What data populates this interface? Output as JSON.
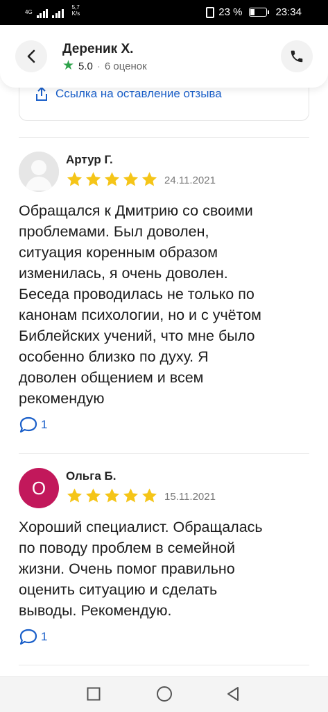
{
  "status_bar": {
    "network_type": "4G",
    "net_speed_value": "5,7",
    "net_speed_unit": "K/s",
    "battery": "23 %",
    "time": "23:34"
  },
  "header": {
    "title": "Дереник Х.",
    "rating": "5.0",
    "separator": "·",
    "reviews_count": "6 оценок"
  },
  "review_link": {
    "label": "Ссылка на оставление отзыва",
    "icon": "share-icon"
  },
  "reviews": [
    {
      "author": "Артур Г.",
      "stars": 5,
      "date": "24.11.2021",
      "text_lines": [
        "Обращался к Дмитрию со своими",
        "проблемами. Был доволен,",
        "ситуация коренным образом",
        "изменилась, я очень доволен.",
        "Беседа проводилась не только по",
        "канонам психологии, но и с учётом",
        "Библейских учений, что мне было",
        "особенно близко по духу. Я",
        "доволен общением и всем",
        "рекомендую"
      ],
      "comments": "1"
    },
    {
      "author": "Ольга Б.",
      "avatar_letter": "О",
      "avatar_color": "#c2185b",
      "stars": 5,
      "date": "15.11.2021",
      "text_lines": [
        "Хороший специалист. Обращалась",
        "по поводу проблем в семейной",
        "жизни. Очень помог правильно",
        "оценить ситуацию и сделать",
        "выводы. Рекомендую."
      ],
      "comments": "1"
    }
  ],
  "colors": {
    "accent_blue": "#1a5fc9",
    "star_gold": "#f5c518",
    "star_green": "#2da24a"
  }
}
